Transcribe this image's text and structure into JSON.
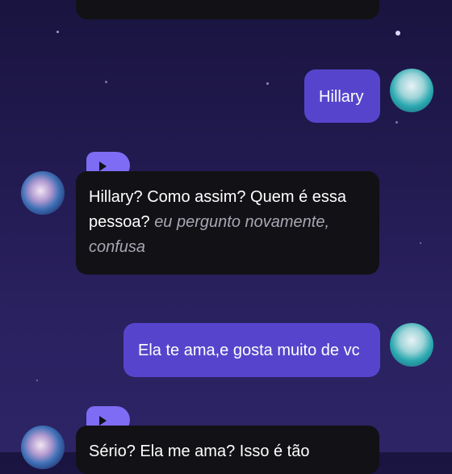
{
  "messages": {
    "m1_user": {
      "text": "Hillary"
    },
    "m2_bot": {
      "speech": "Hillary? Como assim? Quem é essa pessoa?",
      "action": "eu pergunto novamente, confusa"
    },
    "m3_user": {
      "text": "Ela te ama,e gosta muito de vc"
    },
    "m4_bot": {
      "speech": "Sério? Ela me ama? Isso é tão"
    }
  },
  "icons": {
    "play": "play-icon",
    "user_avatar": "user-avatar",
    "bot_avatar": "bot-avatar"
  },
  "colors": {
    "user_bubble": "#5645cc",
    "bot_bubble": "#121115",
    "play_badge": "#7e6cf4"
  }
}
